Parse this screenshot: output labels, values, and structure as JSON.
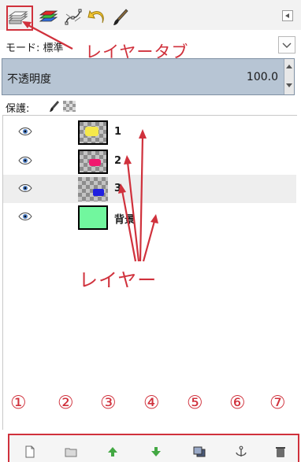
{
  "tabs": {
    "items": [
      {
        "name": "layers"
      },
      {
        "name": "channels"
      },
      {
        "name": "paths"
      },
      {
        "name": "undo-history"
      },
      {
        "name": "brushes"
      }
    ]
  },
  "mode": {
    "label": "モード: 標準"
  },
  "opacity": {
    "label": "不透明度",
    "value": "100.0"
  },
  "lock": {
    "label": "保護:"
  },
  "layers": [
    {
      "name": "1",
      "visible": true,
      "selected": true,
      "thumb_color": "#f5e84a"
    },
    {
      "name": "2",
      "visible": true,
      "selected": true,
      "thumb_color": "#f0186e"
    },
    {
      "name": "3",
      "visible": true,
      "active": true,
      "selected": false,
      "thumb_color": "#2020e0"
    },
    {
      "name": "背景",
      "visible": true,
      "selected": false,
      "thumb_color": "#71f79e"
    }
  ],
  "annotations": {
    "tab_label": "レイヤータブ",
    "layer_label": "レイヤー",
    "numbers": [
      "①",
      "②",
      "③",
      "④",
      "⑤",
      "⑥",
      "⑦"
    ],
    "color": "#d0313c"
  },
  "toolbar": {
    "buttons": [
      {
        "icon": "new-layer-icon"
      },
      {
        "icon": "new-layer-group-icon"
      },
      {
        "icon": "raise-layer-icon"
      },
      {
        "icon": "lower-layer-icon"
      },
      {
        "icon": "duplicate-layer-icon"
      },
      {
        "icon": "anchor-layer-icon"
      },
      {
        "icon": "delete-layer-icon"
      }
    ]
  }
}
